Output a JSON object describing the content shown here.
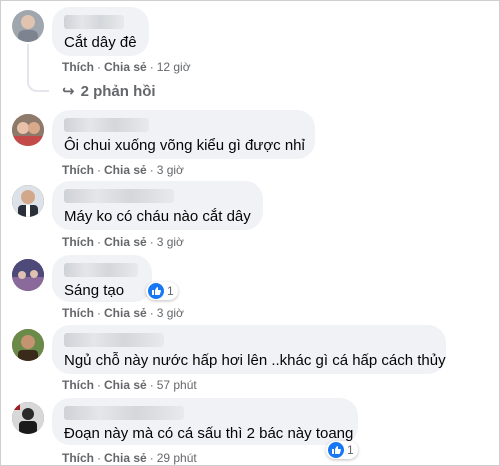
{
  "comments": [
    {
      "text": "Cắt dây đê",
      "like": "Thích",
      "share": "Chia sẻ",
      "time": "12 giờ",
      "replies": "2 phản hồi",
      "avatar_color": "#a0a6ad"
    },
    {
      "text": "Ôi chui xuống võng kiểu gì được nhỉ",
      "like": "Thích",
      "share": "Chia sẻ",
      "time": "3 giờ",
      "avatar_color": "#b9826f"
    },
    {
      "text": "Máy ko có cháu nào cắt dây",
      "like": "Thích",
      "share": "Chia sẻ",
      "time": "3 giờ",
      "avatar_color": "#3b3f4a"
    },
    {
      "text": "Sáng tạo",
      "like": "Thích",
      "share": "Chia sẻ",
      "time": "3 giờ",
      "reaction_count": "1",
      "avatar_color": "#5b4a7a"
    },
    {
      "text": "Ngủ chỗ này nước hấp hơi lên ..khác gì cá hấp cách thủy",
      "like": "Thích",
      "share": "Chia sẻ",
      "time": "57 phút",
      "avatar_color": "#7a5a3a"
    },
    {
      "text": "Đoạn này mà có cá sấu thì 2 bác này toang",
      "like": "Thích",
      "share": "Chia sẻ",
      "time": "29 phút",
      "reaction_count": "1",
      "avatar_color": "#4a4a4a"
    }
  ],
  "colors": {
    "bubble": "#f0f2f5",
    "meta": "#65676b",
    "like_blue": "#1877f2"
  },
  "icons": {
    "reply_arrow": "reply-arrow-icon",
    "like": "like-icon"
  }
}
